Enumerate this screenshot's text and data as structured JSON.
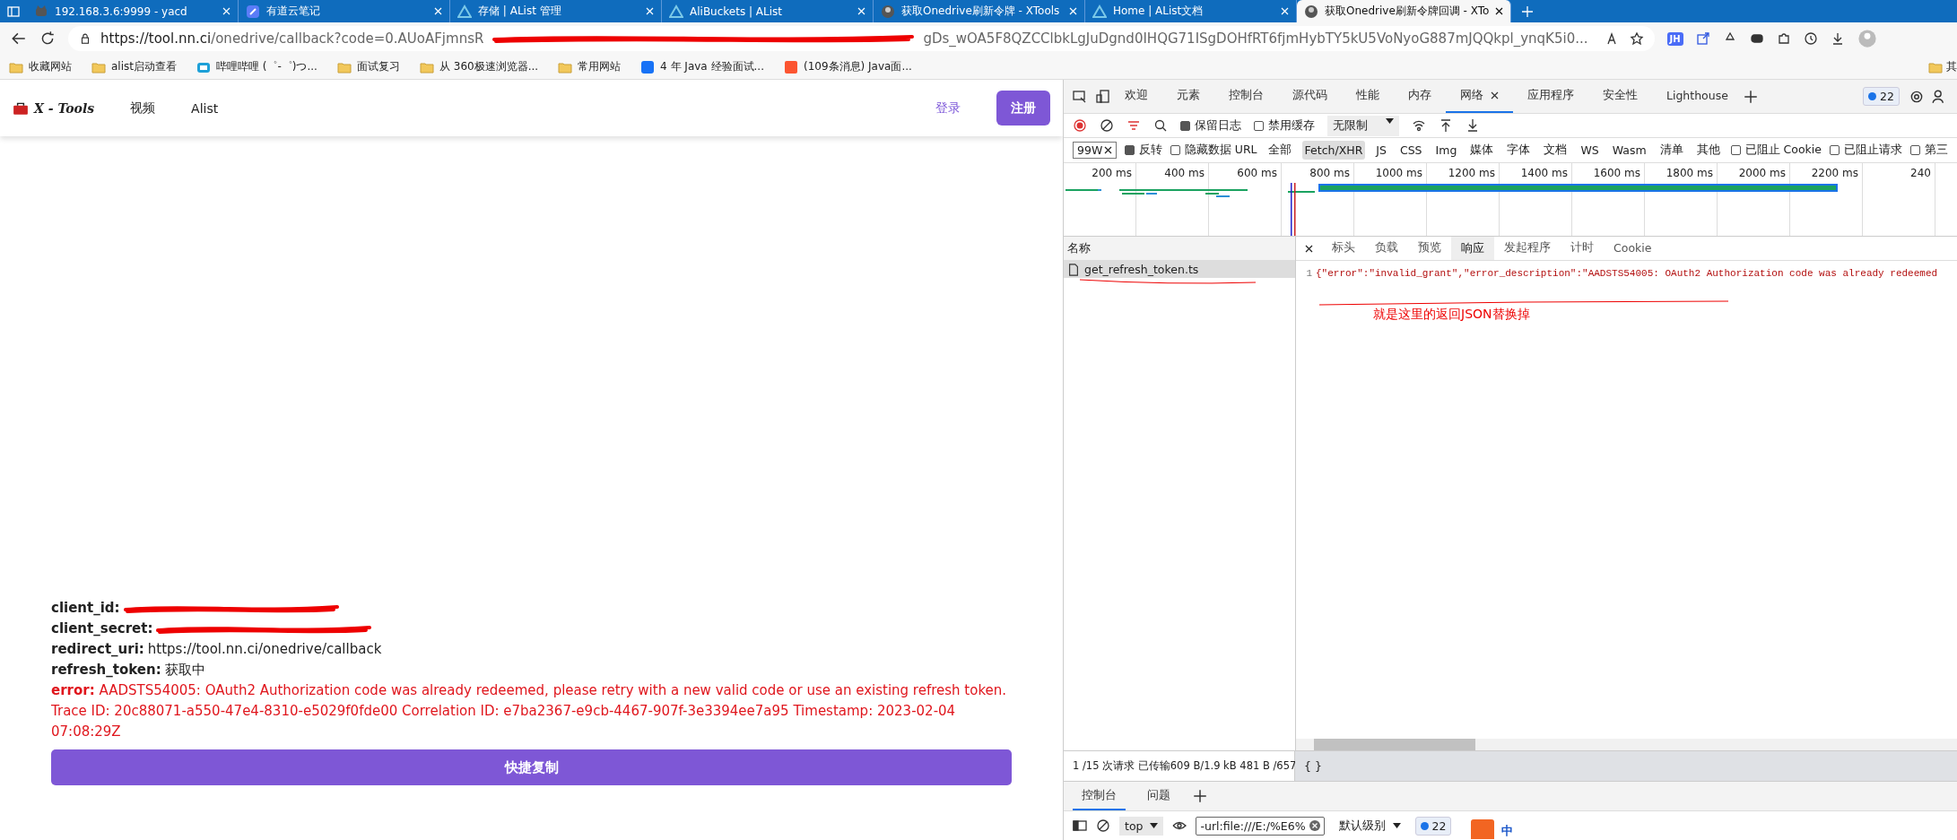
{
  "browser": {
    "tabs": [
      {
        "title": "192.168.3.6:9999 - yacd",
        "kind": "cat",
        "selected": false
      },
      {
        "title": "有道云笔记",
        "kind": "note",
        "selected": false
      },
      {
        "title": "存储 | AList 管理",
        "kind": "alist",
        "selected": false
      },
      {
        "title": "AliBuckets | AList",
        "kind": "alist",
        "selected": false
      },
      {
        "title": "获取Onedrive刷新令牌 - XTools",
        "kind": "avatar",
        "selected": false
      },
      {
        "title": "Home | AList文档",
        "kind": "alist",
        "selected": false
      },
      {
        "title": "获取Onedrive刷新令牌回调 - XTo",
        "kind": "avatar",
        "selected": true
      }
    ],
    "address": {
      "host": "https://tool.nn.ci",
      "path_start": "/onedrive/callback?code=0.AUoAFjmnsR",
      "path_end": "gDs_wOA5F8QZCClbkLgJuDgnd0IHQG71ISgDOHfRT6fjmHybTY5kU5VoNyoG887mJQQkpl_ynqK5i0..."
    },
    "extensions": [
      "JH"
    ],
    "bookmarks": [
      {
        "label": "收藏网站",
        "kind": "folder"
      },
      {
        "label": "alist启动查看",
        "kind": "folder"
      },
      {
        "label": "哔哩哔哩 (゜-゜)つ...",
        "kind": "bili"
      },
      {
        "label": "面试复习",
        "kind": "folder"
      },
      {
        "label": "从 360极速浏览器...",
        "kind": "folder"
      },
      {
        "label": "常用网站",
        "kind": "folder"
      },
      {
        "label": "4 年 Java 经验面试...",
        "kind": "zhihu"
      },
      {
        "label": "(109条消息) Java面...",
        "kind": "csdn"
      }
    ],
    "other_bookmarks": "其"
  },
  "page": {
    "logo": "X - Tools",
    "nav": [
      "视频",
      "Alist"
    ],
    "login": "登录",
    "register": "注册",
    "fields": [
      {
        "label": "client_id:",
        "redacted": true
      },
      {
        "label": "client_secret:",
        "redacted": true
      },
      {
        "label": "redirect_uri:",
        "value": "https://tool.nn.ci/onedrive/callback"
      },
      {
        "label": "refresh_token:",
        "value": "获取中"
      }
    ],
    "error": {
      "label": "error:",
      "text": "AADSTS54005: OAuth2 Authorization code was already redeemed, please retry with a new valid code or use an existing refresh token. Trace ID: 20c88071-a550-47e4-8310-e5029f0fde00 Correlation ID: e7ba2367-e9cb-4467-907f-3e3394ee7a95 Timestamp: 2023-02-04 07:08:29Z"
    },
    "copy_button": "快捷复制"
  },
  "devtools": {
    "tabs": [
      {
        "label": "欢迎",
        "selected": false
      },
      {
        "label": "元素",
        "selected": false
      },
      {
        "label": "控制台",
        "selected": false
      },
      {
        "label": "源代码",
        "selected": false
      },
      {
        "label": "性能",
        "selected": false
      },
      {
        "label": "内存",
        "selected": false
      },
      {
        "label": "网络",
        "selected": true
      },
      {
        "label": "应用程序",
        "selected": false
      },
      {
        "label": "安全性",
        "selected": false
      },
      {
        "label": "Lighthouse",
        "selected": false
      }
    ],
    "issues_badge": "22",
    "preserve_log": {
      "label": "保留日志",
      "checked": true
    },
    "disable_cache": {
      "label": "禁用缓存",
      "checked": false
    },
    "throttle": "无限制",
    "filter": {
      "value": "99W"
    },
    "invert": {
      "label": "反转",
      "checked": true
    },
    "hide_data_urls": {
      "label": "隐藏数据 URL",
      "checked": false
    },
    "types": [
      {
        "label": "全部",
        "selected": false
      },
      {
        "label": "Fetch/XHR",
        "selected": true
      },
      {
        "label": "JS",
        "selected": false
      },
      {
        "label": "CSS",
        "selected": false
      },
      {
        "label": "Img",
        "selected": false
      },
      {
        "label": "媒体",
        "selected": false
      },
      {
        "label": "字体",
        "selected": false
      },
      {
        "label": "文档",
        "selected": false
      },
      {
        "label": "WS",
        "selected": false
      },
      {
        "label": "Wasm",
        "selected": false
      },
      {
        "label": "清单",
        "selected": false
      },
      {
        "label": "其他",
        "selected": false
      }
    ],
    "blocked": [
      {
        "label": "已阻止 Cookie",
        "checked": false
      },
      {
        "label": "已阻止请求",
        "checked": false
      },
      {
        "label": "第三",
        "checked": false
      }
    ],
    "ticks": [
      "200 ms",
      "400 ms",
      "600 ms",
      "800 ms",
      "1000 ms",
      "1200 ms",
      "1400 ms",
      "1600 ms",
      "1800 ms",
      "2000 ms",
      "2200 ms",
      "240"
    ],
    "requests_header": "名称",
    "requests": [
      {
        "name": "get_refresh_token.ts",
        "selected": true
      }
    ],
    "detail_tabs": [
      {
        "label": "标头",
        "selected": false
      },
      {
        "label": "负载",
        "selected": false
      },
      {
        "label": "预览",
        "selected": false
      },
      {
        "label": "响应",
        "selected": true
      },
      {
        "label": "发起程序",
        "selected": false
      },
      {
        "label": "计时",
        "selected": false
      },
      {
        "label": "Cookie",
        "selected": false
      }
    ],
    "response": {
      "line": "1",
      "text": "{\"error\":\"invalid_grant\",\"error_description\":\"AADSTS54005: OAuth2 Authorization code was already redeemed"
    },
    "annotation": "就是这里的返回JSON替换掉",
    "status": "1 /15 次请求  已传输609 B/1.9 kB  481 B /657",
    "pretty_print": "{ }",
    "drawer_tabs": [
      {
        "label": "控制台",
        "selected": true
      },
      {
        "label": "问题",
        "selected": false
      }
    ],
    "console": {
      "context": "top",
      "filter": "-url:file:///E:/%E6%",
      "level": "默认级别",
      "badge": "22"
    },
    "ime": "中"
  }
}
